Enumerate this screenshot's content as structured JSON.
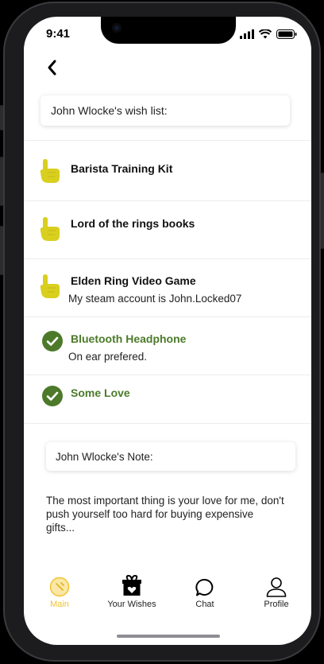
{
  "status": {
    "time": "9:41"
  },
  "header": {
    "wishlist_title": "John Wlocke's wish list:"
  },
  "wishes": [
    {
      "title": "Barista Training Kit",
      "note": "",
      "status": "pending"
    },
    {
      "title": "Lord of the rings books",
      "note": "",
      "status": "pending"
    },
    {
      "title": "Elden Ring Video Game",
      "note": "My steam account is John.Locked07",
      "status": "pending"
    },
    {
      "title": "Bluetooth Headphone",
      "note": "On ear prefered.",
      "status": "done"
    },
    {
      "title": "Some Love",
      "note": "",
      "status": "done"
    }
  ],
  "note": {
    "title": "John Wlocke's Note:",
    "body": "The most important thing is your love for me, don't push yourself too hard for buying expensive gifts..."
  },
  "tabs": {
    "main": "Main",
    "wishes": "Your Wishes",
    "chat": "Chat",
    "profile": "Profile"
  },
  "colors": {
    "accent_yellow": "#f2c230",
    "pointer_yellow": "#d9cf1e",
    "done_green": "#4c7a2a"
  },
  "icons": {
    "pending": "pointing-hand-icon",
    "done": "check-circle-icon"
  }
}
